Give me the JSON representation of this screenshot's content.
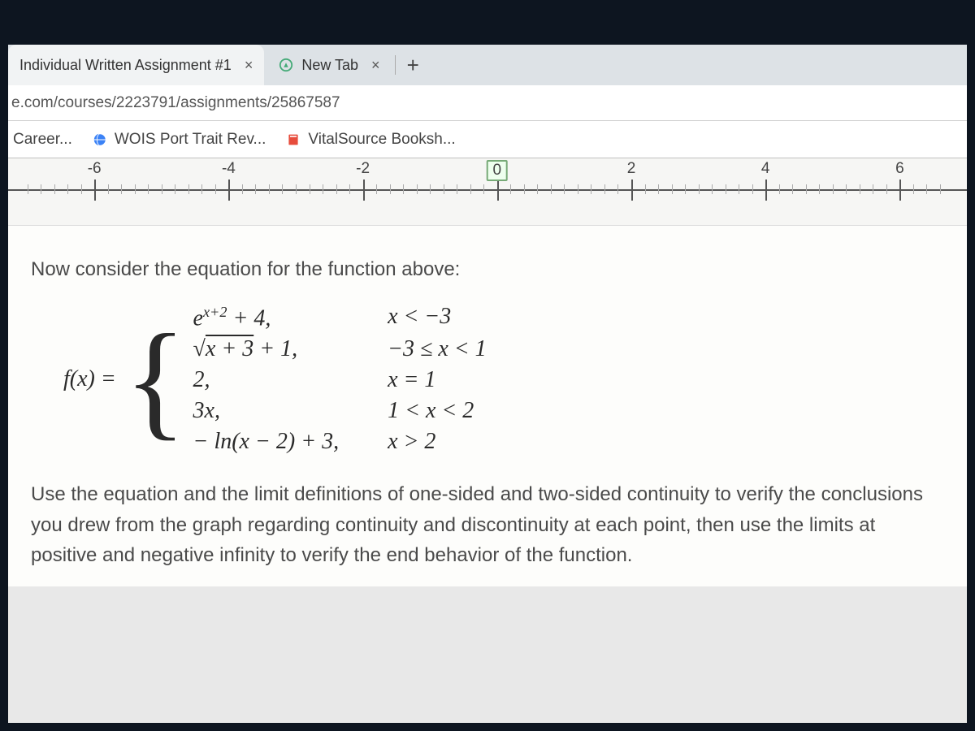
{
  "tabs": [
    {
      "title": "Individual Written Assignment #1",
      "favicon": ""
    },
    {
      "title": "New Tab",
      "favicon": "compass"
    }
  ],
  "url": "e.com/courses/2223791/assignments/25867587",
  "bookmarks": [
    {
      "label": "Career...",
      "icon": ""
    },
    {
      "label": "WOIS Port Trait Rev...",
      "icon": "globe"
    },
    {
      "label": "VitalSource Booksh...",
      "icon": "book"
    }
  ],
  "number_line": {
    "ticks": [
      {
        "pos": 9,
        "label": "-6"
      },
      {
        "pos": 23,
        "label": "-4"
      },
      {
        "pos": 37,
        "label": "-2"
      },
      {
        "pos": 51,
        "label": "0",
        "boxed": true
      },
      {
        "pos": 65,
        "label": "2"
      },
      {
        "pos": 79,
        "label": "4"
      },
      {
        "pos": 93,
        "label": "6"
      }
    ]
  },
  "prompt_text": "Now consider the equation for the function above:",
  "piecewise": {
    "lhs": "f(x) =",
    "rows": [
      {
        "expr_html": "e<sup>x+2</sup> + 4,",
        "cond": "x < −3"
      },
      {
        "expr_html": "√<span style='text-decoration:overline'>x + 3</span> + 1,",
        "cond": "−3 ≤ x < 1"
      },
      {
        "expr_html": "2,",
        "cond": "x = 1"
      },
      {
        "expr_html": "3x,",
        "cond": "1 < x < 2"
      },
      {
        "expr_html": "− ln(x − 2) + 3,",
        "cond": "x > 2"
      }
    ]
  },
  "explain_text": "Use the equation and the limit definitions of one-sided and two-sided continuity to verify the conclusions you drew from the graph regarding continuity and discontinuity at each point, then use the limits at positive and negative infinity to verify the end behavior of the function."
}
